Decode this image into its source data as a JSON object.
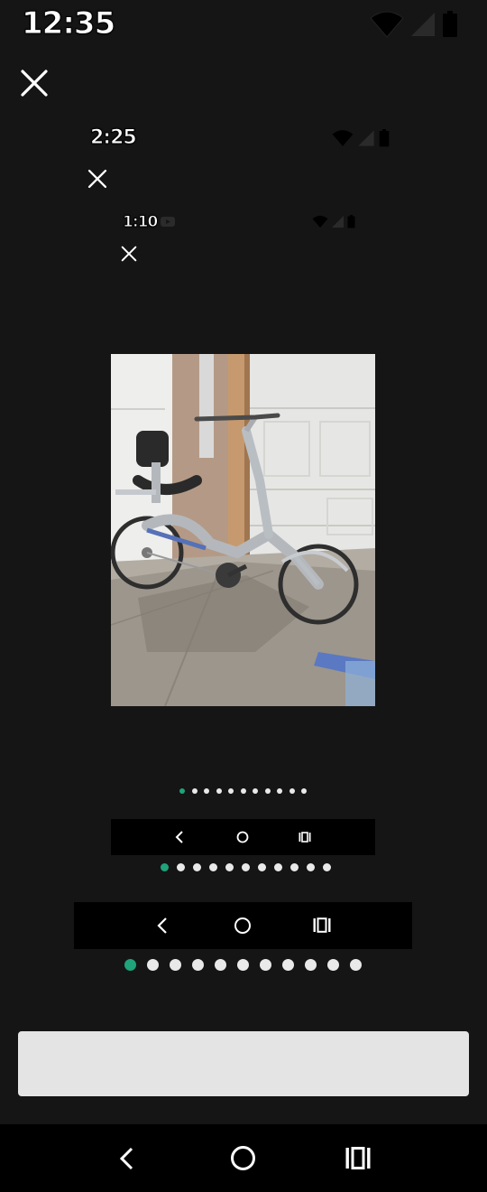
{
  "status_bars": [
    {
      "time": "12:35"
    },
    {
      "time": "2:25"
    },
    {
      "time": "1:10"
    }
  ],
  "gallery": {
    "page_count": 11,
    "active_index": 0
  },
  "colors": {
    "background": "#151515",
    "active_dot": "#1fa37a",
    "inactive_dot": "#e9e9e9",
    "nav_bar": "#000000",
    "input_bar": "#e4e4e4"
  },
  "icons": {
    "close": "close-icon",
    "wifi": "wifi-icon",
    "signal": "signal-icon",
    "battery": "battery-icon",
    "back": "back-icon",
    "home": "home-icon",
    "recents": "recents-icon"
  }
}
